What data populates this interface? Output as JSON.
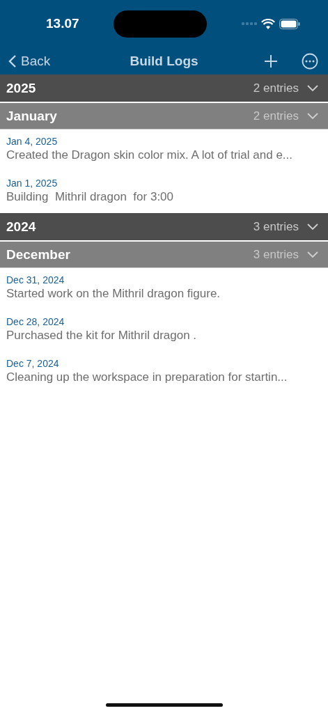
{
  "status_bar": {
    "time": "13.07"
  },
  "nav": {
    "back": "Back",
    "title": "Build Logs"
  },
  "years": [
    {
      "label": "2025",
      "count": "2 entries",
      "expanded": true,
      "months": [
        {
          "label": "January",
          "count": "2 entries",
          "expanded": true,
          "entries": [
            {
              "date": "Jan 4, 2025",
              "text": "Created the Dragon skin color mix. A lot of trial and e..."
            },
            {
              "date": "Jan 1, 2025",
              "text": "Building  Mithril dragon  for 3:00"
            }
          ]
        }
      ]
    },
    {
      "label": "2024",
      "count": "3 entries",
      "expanded": true,
      "months": [
        {
          "label": "December",
          "count": "3 entries",
          "expanded": true,
          "entries": [
            {
              "date": "Dec 31, 2024",
              "text": "Started work on the Mithril dragon figure."
            },
            {
              "date": "Dec 28, 2024",
              "text": "Purchased the kit for Mithril dragon ."
            },
            {
              "date": "Dec 7, 2024",
              "text": "Cleaning up the workspace in preparation for startin..."
            }
          ]
        }
      ]
    }
  ]
}
